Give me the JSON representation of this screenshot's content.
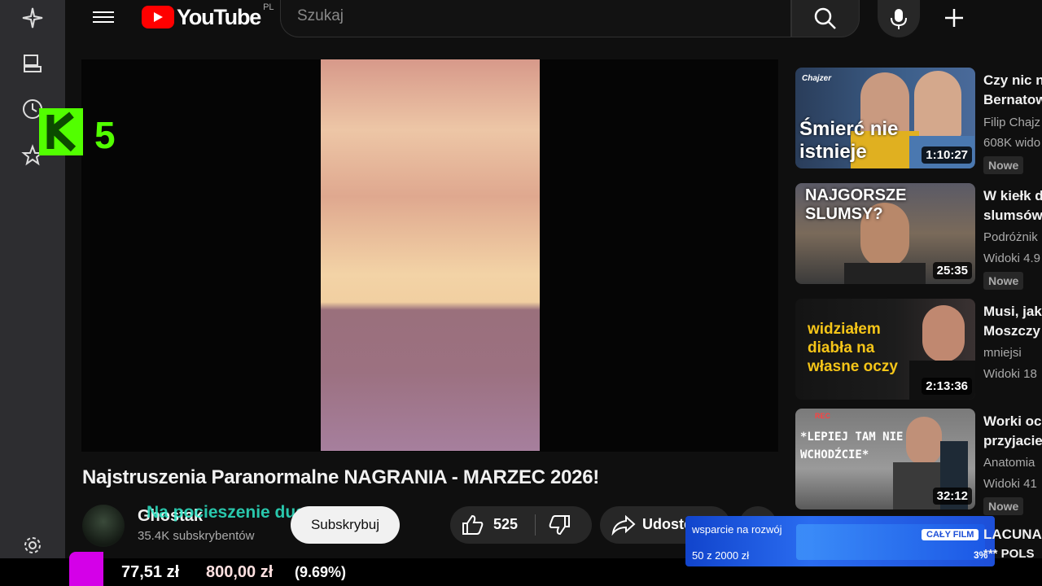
{
  "header": {
    "logo_text": "YouTube",
    "country_code": "PL",
    "search_placeholder": "Szukaj"
  },
  "video": {
    "title": "Najstruszenia Paranormalne NAGRANIA - MARZEC 2026!",
    "channel_name": "Ghostak",
    "subscribers": "35.4K subskrybentów",
    "subscribe_label": "Subskrybuj",
    "likes": "525",
    "share_label": "Udostępnij",
    "overlay_text": "Na pocieszenie duszy"
  },
  "stream_logo": {
    "letter": "K",
    "number": "5"
  },
  "recommendations": [
    {
      "title": "Czy nic n",
      "title2": "Bernatow",
      "channel": "Filip Chajz",
      "views": "608K wido",
      "duration": "1:10:27",
      "badge": "Nowe",
      "thumb_text": "Śmierć nie istnieje",
      "brand": "Chajzer"
    },
    {
      "title": "W kiełk d",
      "title2": "slumsów",
      "channel": "Podróżnik",
      "views": "Widoki 4.9",
      "duration": "25:35",
      "badge": "Nowe",
      "thumb_text": "NAJGORSZE SLUMSY?"
    },
    {
      "title": "Musi, jak",
      "title2": "Moszczy",
      "channel": "mniejsi",
      "views": "Widoki 18",
      "duration": "2:13:36",
      "thumb_text": "widziałem diabła na własne oczy"
    },
    {
      "title": "Worki oc",
      "title2": "przyjacie",
      "channel": "Anatomia",
      "views": "Widoki 41",
      "duration": "32:12",
      "badge": "Nowe",
      "thumb_text": "*LEPIEJ TAM NIE WCHODŹCIE*",
      "rec_label": "REC"
    }
  ],
  "partial_rec_title": "LACUNA",
  "partial_rec_sub": "*** POLS",
  "bottom_bar": {
    "amount1": "77,51 zł",
    "amount2": "800,00 zł",
    "percent": "(9.69%)"
  },
  "donation": {
    "text": "wsparcie na rozwój",
    "progress": "50 z 2000 zł",
    "badge": "CAŁY FILM",
    "percent": "3%"
  },
  "colors": {
    "accent_red": "#ff0000",
    "k5_green": "#52ff00",
    "donation_blue": "#1d4fd8",
    "magenta": "#d400e8"
  }
}
